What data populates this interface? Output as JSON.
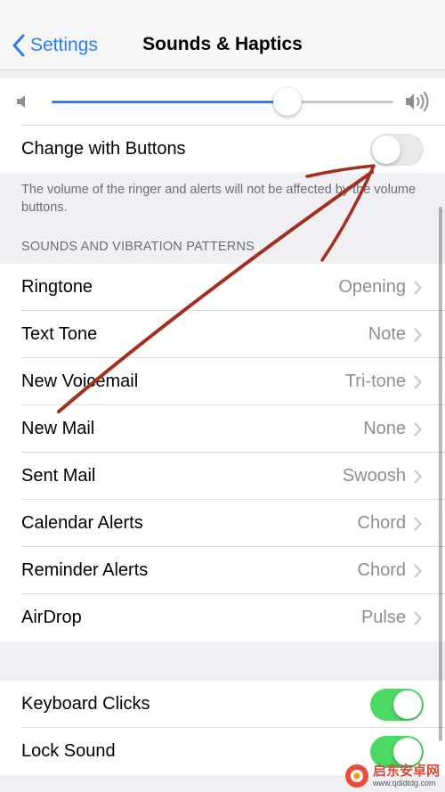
{
  "nav": {
    "back_label": "Settings",
    "title": "Sounds & Haptics"
  },
  "ringer": {
    "volume_fraction": 0.69,
    "change_with_buttons_label": "Change with Buttons",
    "change_with_buttons_on": false,
    "footnote": "The volume of the ringer and alerts will not be affected by the volume buttons."
  },
  "sounds": {
    "header": "SOUNDS AND VIBRATION PATTERNS",
    "items": [
      {
        "label": "Ringtone",
        "value": "Opening"
      },
      {
        "label": "Text Tone",
        "value": "Note"
      },
      {
        "label": "New Voicemail",
        "value": "Tri-tone"
      },
      {
        "label": "New Mail",
        "value": "None"
      },
      {
        "label": "Sent Mail",
        "value": "Swoosh"
      },
      {
        "label": "Calendar Alerts",
        "value": "Chord"
      },
      {
        "label": "Reminder Alerts",
        "value": "Chord"
      },
      {
        "label": "AirDrop",
        "value": "Pulse"
      }
    ]
  },
  "system": {
    "items": [
      {
        "label": "Keyboard Clicks",
        "on": true
      },
      {
        "label": "Lock Sound",
        "on": true
      }
    ]
  },
  "watermark": {
    "title": "启东安卓网",
    "url": "www.qdidtdg.com"
  },
  "colors": {
    "accent": "#2b7cf6",
    "toggle_on": "#4cd964",
    "annotation": "#a3301f",
    "background": "#efeff4"
  },
  "icons": [
    "chevron-left-icon",
    "speaker-low-icon",
    "speaker-high-icon",
    "chevron-right-icon",
    "watermark-logo-icon"
  ]
}
